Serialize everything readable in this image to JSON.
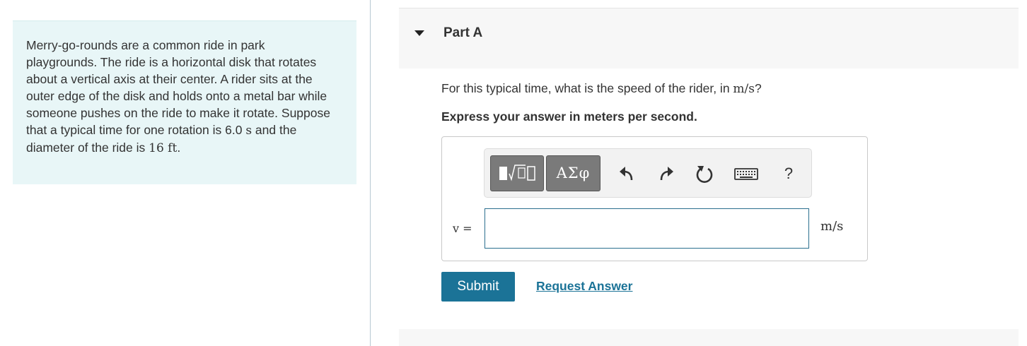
{
  "problem": {
    "text": "Merry-go-rounds are a common ride in park playgrounds. The ride is a horizontal disk that rotates about a vertical axis at their center. A rider sits at the outer edge of the disk and holds onto a metal bar while someone pushes on the ride to make it rotate. Suppose that a typical time for one rotation is 6.0 ",
    "time_unit": "s",
    "text_mid": " and the diameter of the ride is ",
    "diameter_value": "16 ft",
    "text_end": "."
  },
  "part": {
    "title": "Part A",
    "question_prefix": "For this typical time, what is the speed of the rider, in ",
    "question_unit": "m/s",
    "question_suffix": "?",
    "instruction": "Express your answer in meters per second."
  },
  "toolbar": {
    "symbols_label": "ΑΣφ",
    "help_label": "?",
    "icons": [
      "templates-icon",
      "greek-symbols-icon",
      "undo-icon",
      "redo-icon",
      "reset-icon",
      "keyboard-icon",
      "help-icon"
    ]
  },
  "answer": {
    "variable_label": "v =",
    "value": "",
    "unit": "m/s"
  },
  "actions": {
    "submit_label": "Submit",
    "request_label": "Request Answer"
  },
  "colors": {
    "problem_bg": "#e8f6f7",
    "accent": "#1b7397",
    "tool_button_bg": "#7a7a7a"
  }
}
